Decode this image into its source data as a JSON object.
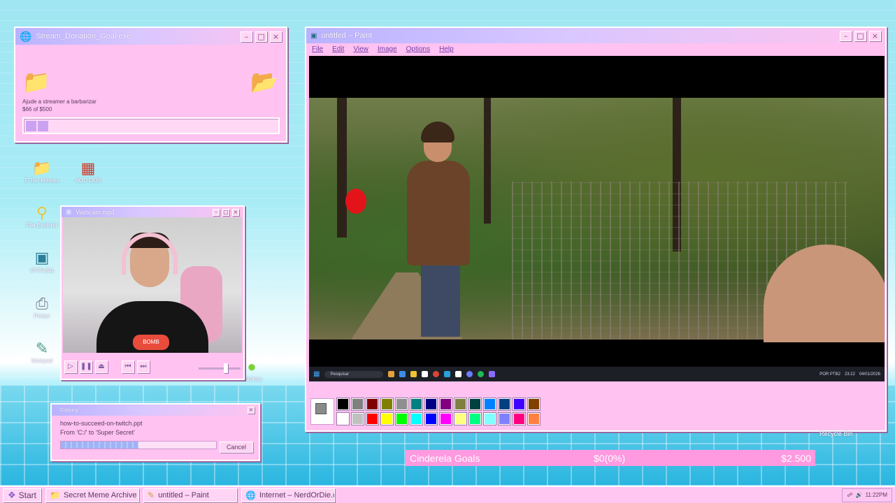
{
  "donation": {
    "title": "Stream_Donation_Goal.exe",
    "text": "Ajude a streamer a barbarizar",
    "amount": "$66 of $500",
    "progress": 0.132
  },
  "desktop_icons": [
    {
      "label": "Network",
      "icon": "network-icon"
    },
    {
      "label": "5-Tier Memes",
      "icon": "folder-icon"
    },
    {
      "label": "NOD-DOS",
      "icon": "nod-dos-icon"
    },
    {
      "label": "File Explorer",
      "icon": "magnifier-icon"
    },
    {
      "label": "photo.jpg",
      "icon": "image-icon"
    },
    {
      "label": "Printer",
      "icon": "printer-icon"
    },
    {
      "label": "Notepad",
      "icon": "notepad-icon"
    },
    {
      "label": "Winamp",
      "icon": "winamp-icon"
    }
  ],
  "webcam": {
    "title": "Webcam.mp4",
    "shirt_text": "BOMB"
  },
  "copying": {
    "title": "Copying...",
    "file": "how-to-succeed-on-twitch.ppt",
    "from": "From 'C:/' to 'Super Secret'",
    "cancel": "Cancel",
    "progress": 0.5
  },
  "paint": {
    "title": "untitled – Paint",
    "menu": [
      "File",
      "Edit",
      "View",
      "Image",
      "Options",
      "Help"
    ],
    "inner_taskbar": {
      "search": "Pesquisar",
      "lang": "POR PTB2",
      "time": "23:22",
      "date": "04/01/2026"
    },
    "palette_top": [
      "#000000",
      "#808080",
      "#800000",
      "#808000",
      "#8f8f8f",
      "#008080",
      "#000080",
      "#800080",
      "#808040",
      "#004040",
      "#0080ff",
      "#004080",
      "#4000ff",
      "#804000"
    ],
    "palette_bottom": [
      "#ffffff",
      "#c0c0c0",
      "#ff0000",
      "#ffff00",
      "#00ff00",
      "#00ffff",
      "#0000ff",
      "#ff00ff",
      "#ffff80",
      "#00ff80",
      "#80ffff",
      "#8080ff",
      "#ff0080",
      "#ff8040"
    ],
    "current_color": "#8a8a8a"
  },
  "goals": {
    "label": "Cinderela Goals",
    "current": "$0(0%)",
    "target": "$2.500"
  },
  "recycle_bin": "Recycle Bin",
  "taskbar": {
    "start": "Start",
    "tasks": [
      {
        "label": "Secret Meme Archive",
        "icon": "folder-icon"
      },
      {
        "label": "untitled – Paint",
        "icon": "paint-icon"
      },
      {
        "label": "Internet – NerdOrDie.com",
        "icon": "globe-icon"
      }
    ],
    "clock": "11:22PM"
  }
}
